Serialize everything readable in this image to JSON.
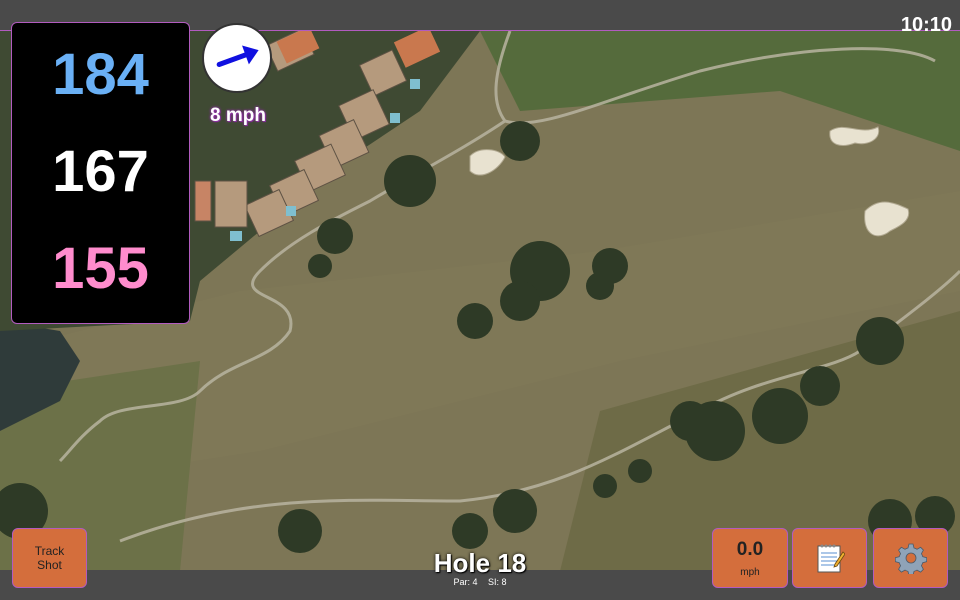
{
  "status": {
    "time": "10:10"
  },
  "distances": {
    "back": "184",
    "middle": "167",
    "front": "155"
  },
  "wind": {
    "speed_label": "8 mph",
    "direction_icon": "arrow-icon",
    "direction_deg": -20
  },
  "hole": {
    "title": "Hole 18",
    "par_label": "Par: 4",
    "si_label": "SI: 8"
  },
  "buttons": {
    "track_shot": "Track\nShot",
    "track_line1": "Track",
    "track_line2": "Shot",
    "speed_value": "0.0",
    "speed_unit": "mph",
    "notes_icon": "notepad-icon",
    "settings_icon": "gear-icon"
  },
  "colors": {
    "back": "#6ab0f5",
    "middle": "#ffffff",
    "front": "#ff8ccd",
    "button": "#d46e3c",
    "panel": "#000000",
    "accent_border": "#b25bbf"
  }
}
